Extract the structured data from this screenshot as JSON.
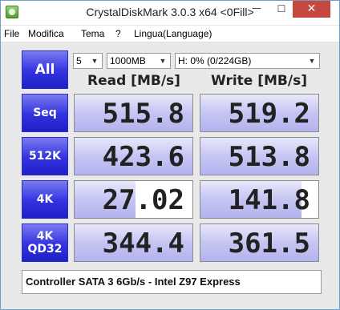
{
  "window": {
    "title": "CrystalDiskMark 3.0.3 x64 <0Fill>",
    "minimize_glyph": "—",
    "maximize_glyph": "☐",
    "close_glyph": "✕"
  },
  "menu": [
    "File",
    "Modifica",
    "Tema",
    "?",
    "Lingua(Language)"
  ],
  "controls": {
    "all_label": "All",
    "count": "5",
    "size": "1000MB",
    "drive": "H: 0% (0/224GB)"
  },
  "headers": {
    "read": "Read [MB/s]",
    "write": "Write [MB/s]"
  },
  "rows": [
    {
      "label": "Seq",
      "read": "515.8",
      "write": "519.2",
      "read_fill": 1.0,
      "write_fill": 1.0
    },
    {
      "label": "512K",
      "read": "423.6",
      "write": "513.8",
      "read_fill": 1.0,
      "write_fill": 1.0
    },
    {
      "label": "4K",
      "read": "27.02",
      "write": "141.8",
      "read_fill": 0.52,
      "write_fill": 0.86
    },
    {
      "label_line1": "4K",
      "label_line2": "QD32",
      "read": "344.4",
      "write": "361.5",
      "read_fill": 1.0,
      "write_fill": 1.0
    }
  ],
  "comment": "Controller SATA 3 6Gb/s - Intel Z97 Express"
}
